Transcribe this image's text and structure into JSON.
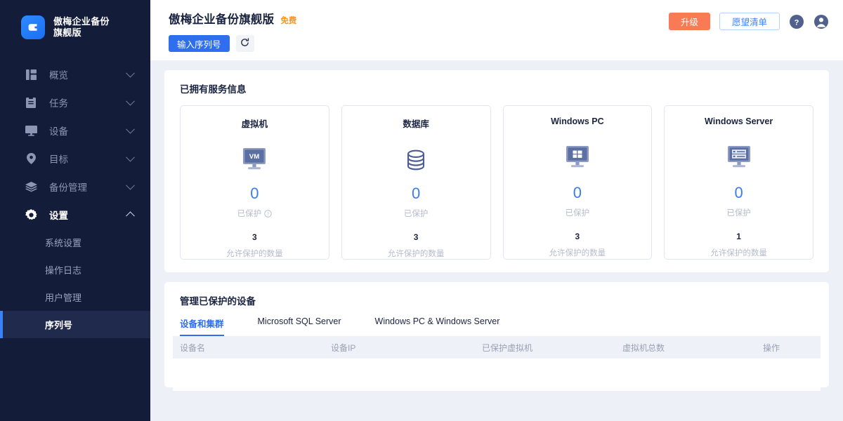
{
  "sidebar": {
    "brand": {
      "line1": "傲梅企业备份",
      "line2": "旗舰版"
    },
    "items": [
      {
        "label": "概览",
        "icon": "dashboard-icon",
        "expanded": false
      },
      {
        "label": "任务",
        "icon": "clipboard-icon",
        "expanded": false
      },
      {
        "label": "设备",
        "icon": "monitor-icon",
        "expanded": false
      },
      {
        "label": "目标",
        "icon": "location-pin-icon",
        "expanded": false
      },
      {
        "label": "备份管理",
        "icon": "layers-icon",
        "expanded": false
      },
      {
        "label": "设置",
        "icon": "gear-icon",
        "expanded": true
      }
    ],
    "subitems": [
      {
        "label": "系统设置",
        "active": false
      },
      {
        "label": "操作日志",
        "active": false
      },
      {
        "label": "用户管理",
        "active": false
      },
      {
        "label": "序列号",
        "active": true
      }
    ]
  },
  "topbar": {
    "app_title": "傲梅企业备份旗舰版",
    "free_badge": "免费",
    "enter_serial_label": "输入序列号",
    "refresh_icon": "refresh-icon",
    "upgrade_label": "升级",
    "wishlist_label": "愿望清单",
    "help_icon": "help-circle-icon",
    "account_icon": "account-circle-icon",
    "accent_blue": "#2f6fef",
    "accent_orange": "#f97a54",
    "badge_orange": "#ff9416"
  },
  "services": {
    "title": "已拥有服务信息",
    "protected_label": "已保护",
    "allowed_label": "允许保护的数量",
    "cards": [
      {
        "title": "虚拟机",
        "icon": "vm-monitor-icon",
        "protected": "0",
        "allowed": "3",
        "has_help": true
      },
      {
        "title": "数据库",
        "icon": "database-icon",
        "protected": "0",
        "allowed": "3",
        "has_help": false
      },
      {
        "title": "Windows PC",
        "icon": "windows-pc-icon",
        "protected": "0",
        "allowed": "3",
        "has_help": false
      },
      {
        "title": "Windows Server",
        "icon": "windows-server-icon",
        "protected": "0",
        "allowed": "1",
        "has_help": false
      }
    ]
  },
  "devices": {
    "title": "管理已保护的设备",
    "tabs": [
      {
        "label": "设备和集群",
        "active": true
      },
      {
        "label": "Microsoft SQL Server",
        "active": false
      },
      {
        "label": "Windows PC & Windows Server",
        "active": false
      }
    ],
    "columns": [
      "设备名",
      "设备IP",
      "已保护虚拟机",
      "虚拟机总数",
      "操作"
    ],
    "rows": []
  }
}
